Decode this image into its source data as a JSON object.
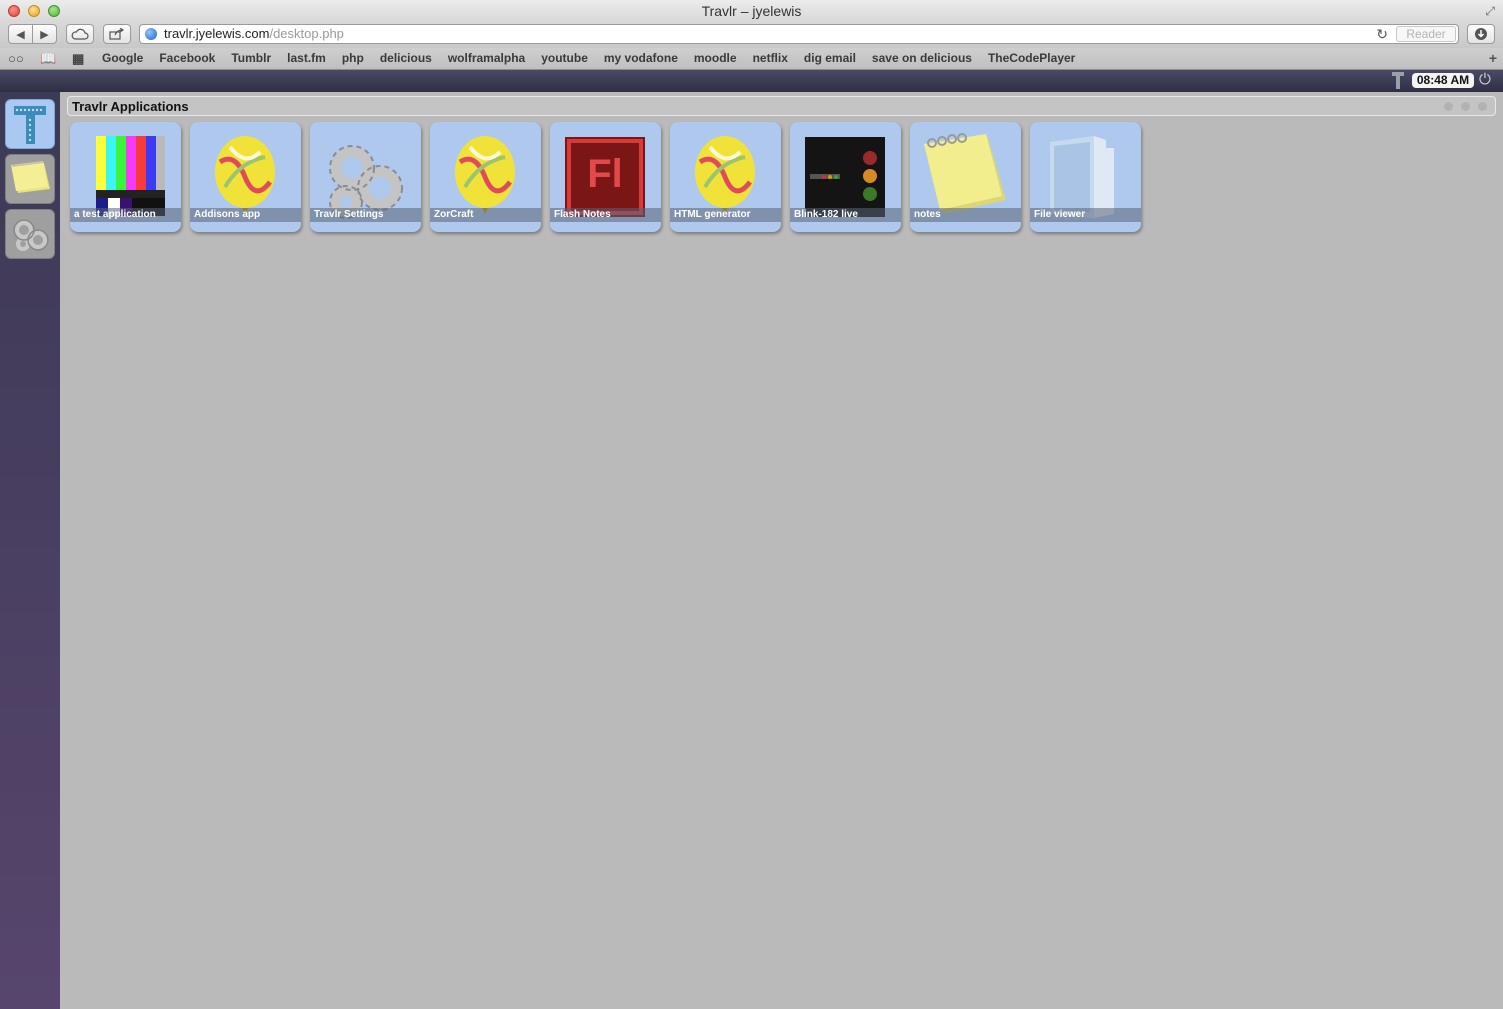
{
  "window": {
    "title": "Travlr – jyelewis"
  },
  "toolbar": {
    "url_host": "travlr.jyelewis.com",
    "url_path": "/desktop.php",
    "reader_label": "Reader"
  },
  "bookmarks": [
    "Google",
    "Facebook",
    "Tumblr",
    "last.fm",
    "php",
    "delicious",
    "wolframalpha",
    "youtube",
    "my vodafone",
    "moodle",
    "netflix",
    "dig email",
    "save on delicious",
    "TheCodePlayer"
  ],
  "topbar": {
    "clock": "08:48 AM"
  },
  "panel": {
    "title": "Travlr Applications"
  },
  "apps": [
    {
      "label": "a test application",
      "icon": "tv-test-pattern-icon"
    },
    {
      "label": "Addisons app",
      "icon": "balloon-icon"
    },
    {
      "label": "Travlr Settings",
      "icon": "gears-icon"
    },
    {
      "label": "ZorCraft",
      "icon": "balloon-icon"
    },
    {
      "label": "Flash Notes",
      "icon": "flash-fl-icon"
    },
    {
      "label": "HTML generator",
      "icon": "balloon-icon"
    },
    {
      "label": "Blink-182 live",
      "icon": "blink-182-icon"
    },
    {
      "label": "notes",
      "icon": "notepad-icon"
    },
    {
      "label": "File viewer",
      "icon": "folder-icon"
    }
  ],
  "flash_icon_text": "Fl",
  "dock": [
    {
      "name": "travlr-applications",
      "icon": "travlr-logo-icon",
      "active": true
    },
    {
      "name": "notes",
      "icon": "notepad-icon",
      "active": false
    },
    {
      "name": "settings",
      "icon": "gears-icon",
      "active": false
    }
  ]
}
